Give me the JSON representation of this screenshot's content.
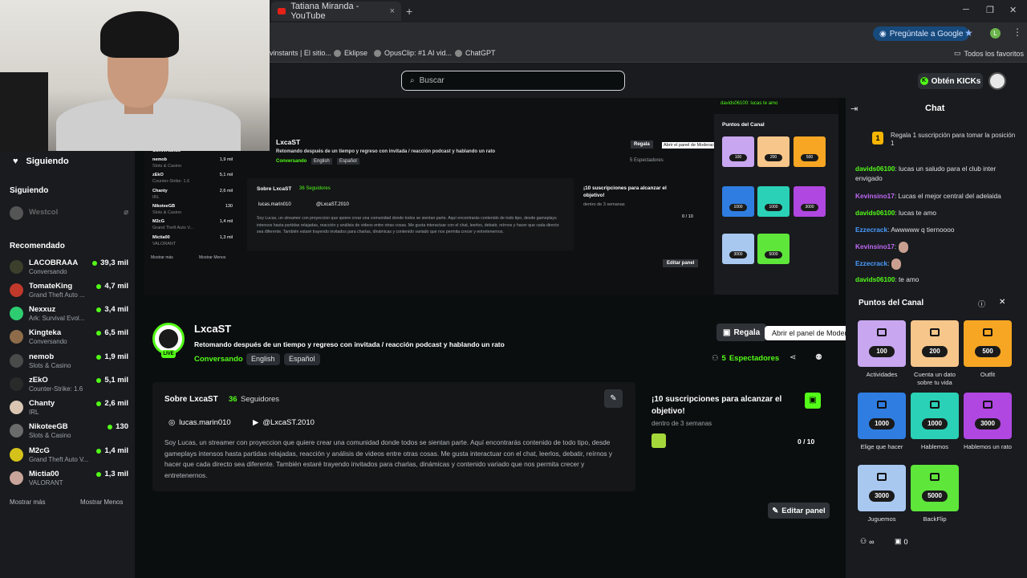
{
  "browser": {
    "tab_title": "Tatiana Miranda - YouTube",
    "tab_close": "×",
    "new_tab": "+",
    "win_min": "─",
    "win_max": "❐",
    "win_close": "✕",
    "google_button": "Pregúntale a Google",
    "profile_letter": "L",
    "bookmarks": [
      "vinstants | El sitio...",
      "Eklipse",
      "OpusClip: #1 AI vid...",
      "ChatGPT"
    ],
    "all_bookmarks": "Todos los favoritos"
  },
  "kick_header": {
    "search_placeholder": "Buscar",
    "get_kicks": "Obtén KICKs"
  },
  "sidebar": {
    "following_header": "Siguiendo",
    "following_label": "Siguiendo",
    "followed_channel": "Westcol",
    "recommended_label": "Recomendado",
    "items": [
      {
        "name": "LACOBRAAA",
        "category": "Conversando",
        "viewers": "39,3 mil",
        "color": "#3b3f2b"
      },
      {
        "name": "TomateKing",
        "category": "Grand Theft Auto ...",
        "viewers": "4,7 mil",
        "color": "#c0392b"
      },
      {
        "name": "Nexxuz",
        "category": "Ark: Survival Evol...",
        "viewers": "3,4 mil",
        "color": "#2ecc71"
      },
      {
        "name": "Kingteka",
        "category": "Conversando",
        "viewers": "6,5 mil",
        "color": "#8e6c4a"
      },
      {
        "name": "nemob",
        "category": "Slots & Casino",
        "viewers": "1,9 mil",
        "color": "#4a4a4a"
      },
      {
        "name": "zEkO",
        "category": "Counter-Strike: 1.6",
        "viewers": "5,1 mil",
        "color": "#2a2a2a"
      },
      {
        "name": "Chanty",
        "category": "IRL",
        "viewers": "2,6 mil",
        "color": "#d9c5b2"
      },
      {
        "name": "NikoteeGB",
        "category": "Slots & Casino",
        "viewers": "130",
        "color": "#6b6b6b"
      },
      {
        "name": "M2cG",
        "category": "Grand Theft Auto V...",
        "viewers": "1,4 mil",
        "color": "#d4c21a"
      },
      {
        "name": "Mictia00",
        "category": "VALORANT",
        "viewers": "1,3 mil",
        "color": "#c9a49a"
      }
    ],
    "show_more": "Mostrar más",
    "show_less": "Mostrar Menos"
  },
  "channel": {
    "name": "LxcaST",
    "live": "LIVE",
    "title": "Retomando después de un tiempo y regreso con invitada / reacción podcast y hablando un rato",
    "category": "Conversando",
    "tags": [
      "English",
      "Español"
    ],
    "gift_button": "Regala",
    "tooltip": "Abrir el panel de Moderación",
    "viewers_count": "5",
    "viewers_label": "Espectadores",
    "about_title": "Sobre LxcaST",
    "followers_count": "36",
    "followers_label": "Seguidores",
    "instagram": "lucas.marin010",
    "youtube": "@LxcaST.2010",
    "bio": "Soy Lucas, un streamer con proyeccion que quiere crear una comunidad donde todos se sientan parte. Aquí encontrarás contenido de todo tipo, desde gameplays intensos hasta partidas relajadas, reacción y análisis de videos entre otras cosas. Me gusta interactuar con el chat, leerlos, debatir, reírnos y hacer que cada directo sea diferente. También estaré trayendo invitados para charlas, dinámicas y contenido variado que nos permita crecer y entretenernos.",
    "goal_title": "¡10 suscripciones para alcanzar el objetivo!",
    "goal_sub": "dentro de 3 semanas",
    "goal_progress": "0 / 10",
    "edit_panel": "Editar panel"
  },
  "chat": {
    "title": "Chat",
    "pinned_num": "1",
    "pinned_text": "Regala 1 suscripción para tomar la posición 1",
    "messages": [
      {
        "user": "davids06100",
        "color": "#53fc18",
        "text": "lucas un saludo para el club inter envigado"
      },
      {
        "user": "Kevinsino17",
        "color": "#c069f5",
        "text": "Lucas el mejor central del adelaida"
      },
      {
        "user": "davids06100",
        "color": "#53fc18",
        "text": "lucas te amo"
      },
      {
        "user": "Ezzecrack",
        "color": "#4a9cff",
        "text": "Awwwww q tiernoooo"
      },
      {
        "user": "Kevinsino17",
        "color": "#c069f5",
        "text": ""
      },
      {
        "user": "Ezzecrack",
        "color": "#4a9cff",
        "text": ""
      },
      {
        "user": "davids06100",
        "color": "#53fc18",
        "text": "te amo"
      }
    ]
  },
  "points": {
    "title": "Puntos del Canal",
    "rewards": [
      {
        "label": "Actividades",
        "cost": "100",
        "color": "#c8a6f0"
      },
      {
        "label": "Cuenta un dato sobre tu vida",
        "cost": "200",
        "color": "#f6c68a"
      },
      {
        "label": "Outfit",
        "cost": "500",
        "color": "#f6a623"
      },
      {
        "label": "Elige que hacer",
        "cost": "1000",
        "color": "#2f7de1"
      },
      {
        "label": "Hablemos",
        "cost": "1000",
        "color": "#2ad1b6"
      },
      {
        "label": "Hablemos un rato",
        "cost": "3000",
        "color": "#b047e0"
      },
      {
        "label": "Juguemos",
        "cost": "3000",
        "color": "#a8c8f0"
      },
      {
        "label": "BackFlip",
        "cost": "5000",
        "color": "#5ee63a"
      }
    ],
    "footer_left": "∞",
    "footer_right": "0"
  },
  "mini": {
    "channel": "LxcaST",
    "title": "Retomando después de un tiempo y regreso con invitada / reacción podcast y hablando un rato",
    "category": "Conversando",
    "tags": [
      "English",
      "Español"
    ],
    "gift": "Regala",
    "tooltip": "Abrir el panel de Moderación",
    "viewers": "5 Espectadores",
    "about": "Sobre LxcaST",
    "followers": "36 Seguidores",
    "insta": "lucas.marin010",
    "yt": "@LxcaST.2010",
    "goal": "¡10 suscripciones para alcanzar el objetivo!",
    "goal_sub": "dentro de 3 semanas",
    "goal_count": "0 / 10",
    "edit": "Editar panel",
    "points_title": "Puntos del Canal",
    "chat_line": "davids06100: lucas te amo",
    "show_more": "Mostrar más",
    "show_less": "Mostrar Menos",
    "sidebar_items": [
      {
        "name": "Conversando",
        "sub": "",
        "v": ""
      },
      {
        "name": "nemob",
        "sub": "Slots & Casino",
        "v": "1,9 mil"
      },
      {
        "name": "zEkO",
        "sub": "Counter-Strike: 1.6",
        "v": "5,1 mil"
      },
      {
        "name": "Chanty",
        "sub": "IRL",
        "v": "2,6 mil"
      },
      {
        "name": "NikoteeGB",
        "sub": "Slots & Casino",
        "v": "130"
      },
      {
        "name": "M2cG",
        "sub": "Grand Theft Auto V...",
        "v": "1,4 mil"
      },
      {
        "name": "Mictia00",
        "sub": "VALORANT",
        "v": "1,3 mil"
      }
    ]
  }
}
